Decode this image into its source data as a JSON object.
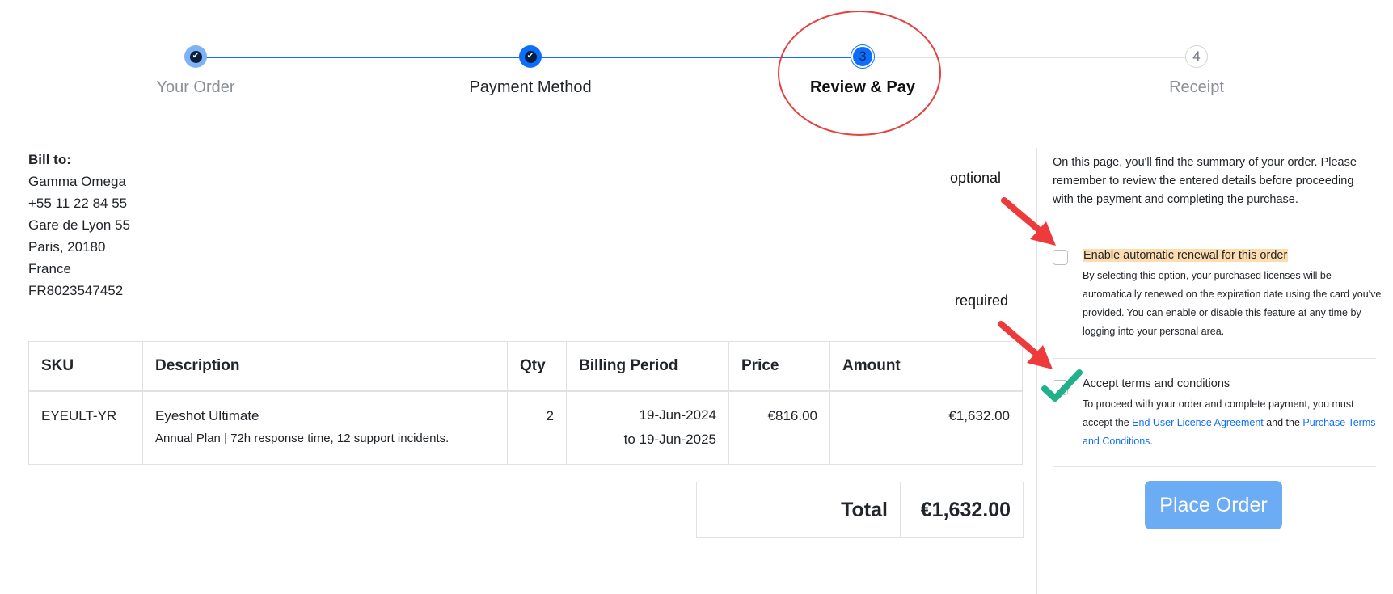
{
  "stepper": {
    "steps": [
      {
        "number": "",
        "label": "Your Order",
        "state": "completed"
      },
      {
        "number": "",
        "label": "Payment Method",
        "state": "completed"
      },
      {
        "number": "3",
        "label": "Review & Pay",
        "state": "current"
      },
      {
        "number": "4",
        "label": "Receipt",
        "state": "pending"
      }
    ]
  },
  "bill_to": {
    "heading": "Bill to:",
    "name": "Gamma Omega",
    "phone": "+55 11 22 84 55",
    "street": "Gare de Lyon 55",
    "city": "Paris, 20180",
    "country": "France",
    "vat": "FR8023547452"
  },
  "table": {
    "headers": [
      "SKU",
      "Description",
      "Qty",
      "Billing Period",
      "Price",
      "Amount"
    ],
    "rows": [
      {
        "sku": "EYEULT-YR",
        "description": "Eyeshot Ultimate",
        "details": "Annual Plan | 72h response time, 12 support incidents.",
        "qty": "2",
        "period_from": "19-Jun-2024",
        "period_to": "to 19-Jun-2025",
        "price": "€816.00",
        "amount": "€1,632.00"
      }
    ]
  },
  "total": {
    "label": "Total",
    "value": "€1,632.00"
  },
  "sidebar": {
    "intro": "On this page, you'll find the summary of your order. Please remember to review the entered details before proceeding with the payment and completing the purchase.",
    "auto_renew": {
      "label": "Enable automatic renewal for this order",
      "checked": false,
      "description": "By selecting this option, your purchased licenses will be automatically renewed on the expiration date using the card you've provided. You can enable or disable this feature at any time by logging into your personal area."
    },
    "terms": {
      "label": "Accept terms and conditions",
      "checked": true,
      "description_before": "To proceed with your order and complete payment, you must accept the ",
      "eula_link": "End User License Agreement",
      "description_middle": " and the ",
      "purchase_terms_link": "Purchase Terms and Conditions",
      "description_after": "."
    },
    "place_order_label": "Place Order"
  },
  "annotations": {
    "optional_label": "optional",
    "required_label": "required",
    "highlight_color": "#e5413f",
    "checkmark_color": "#22b08a"
  },
  "colors": {
    "accent": "#0d6efd",
    "button": "#6cacf5",
    "link": "#0d6efd"
  }
}
